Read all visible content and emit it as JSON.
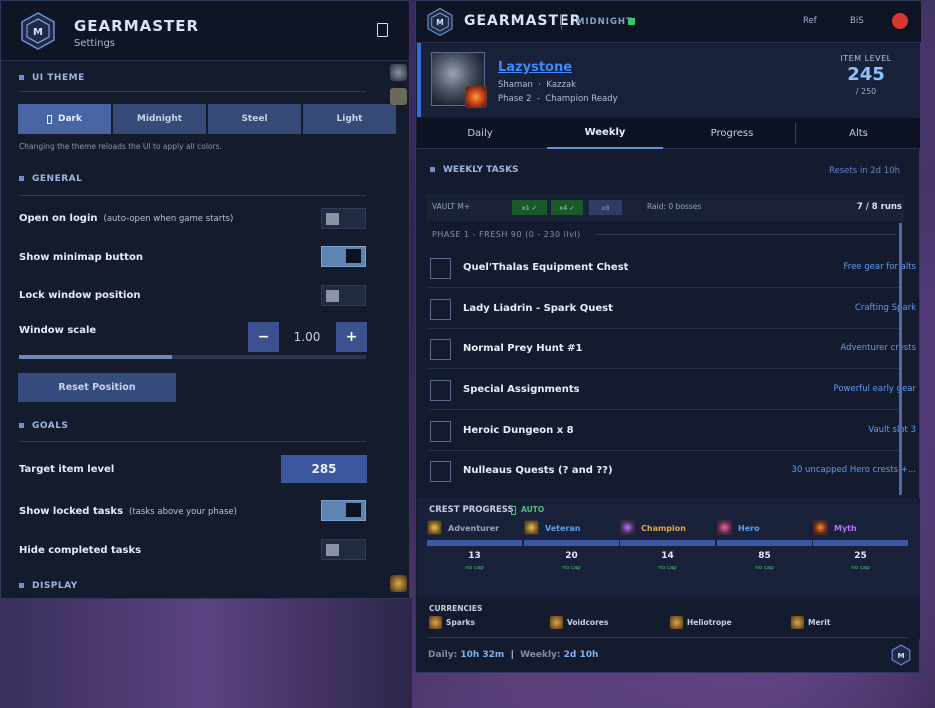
{
  "settings": {
    "app_title": "GEARMASTER",
    "subtitle": "Settings",
    "ui_theme": {
      "header": "UI THEME",
      "options": [
        "Dark",
        "Midnight",
        "Steel",
        "Light"
      ],
      "selected": "Dark",
      "note": "Changing the theme reloads the UI to apply all colors."
    },
    "general": {
      "header": "GENERAL",
      "open_on_login": {
        "label": "Open on login",
        "hint": "(auto-open when game starts)",
        "on": false
      },
      "show_minimap": {
        "label": "Show minimap button",
        "on": true
      },
      "lock_window": {
        "label": "Lock window position",
        "on": false
      },
      "window_scale": {
        "label": "Window scale",
        "value": "1.00",
        "minus": "−",
        "plus": "+",
        "level": 0.44
      },
      "reset_label": "Reset Position"
    },
    "goals": {
      "header": "GOALS",
      "target_ilvl": {
        "label": "Target item level",
        "value": "285"
      },
      "show_locked": {
        "label": "Show locked tasks",
        "hint": "(tasks above your phase)",
        "on": true
      },
      "hide_completed": {
        "label": "Hide completed tasks",
        "on": false
      }
    },
    "display_header": "DISPLAY"
  },
  "tracker": {
    "app_title": "GEARMASTER",
    "theme_name": "MIDNIGHT",
    "links": [
      "Ref",
      "BiS"
    ],
    "character": {
      "name": "Lazystone",
      "class": "Shaman",
      "realm": "Kazzak",
      "phase": "Phase 2",
      "status": "Champion Ready",
      "item_level_label": "ITEM LEVEL",
      "item_level": "245",
      "item_level_max": "/ 250"
    },
    "tabs": [
      "Daily",
      "Weekly",
      "Progress",
      "Alts"
    ],
    "active_tab": "Weekly",
    "weekly": {
      "header": "WEEKLY TASKS",
      "reset": "Resets in 2d 10h",
      "vault_label": "VAULT M+",
      "vault_chips": [
        "x1 ✓",
        "x4 ✓",
        "x8"
      ],
      "raid": "Raid: 0 bosses",
      "runs": "7 / 8 runs",
      "phase_header": "PHASE 1  -  FRESH 90  (0 - 230 ilvl)",
      "tasks": [
        {
          "name": "Quel'Thalas Equipment Chest",
          "note": "Free gear for alts"
        },
        {
          "name": "Lady Liadrin  - Spark Quest",
          "note": "Crafting Spark"
        },
        {
          "name": "Normal Prey Hunt #1",
          "note": "Adventurer crests"
        },
        {
          "name": "Special Assignments",
          "note": "Powerful early gear"
        },
        {
          "name": "Heroic Dungeon  x 8",
          "note": "Vault slot 3"
        },
        {
          "name": "Nulleaus Quests  (? and ??)",
          "note": "30 uncapped Hero crests +..."
        }
      ]
    },
    "crests": {
      "header": "CREST PROGRESS",
      "auto": "AUTO",
      "items": [
        {
          "name": "Adventurer",
          "value": "13",
          "cap": "no cap",
          "color": "#9aa3b5"
        },
        {
          "name": "Veteran",
          "value": "20",
          "cap": "no cap",
          "color": "#5aa2e8"
        },
        {
          "name": "Champion",
          "value": "14",
          "cap": "no cap",
          "color": "#e0a843"
        },
        {
          "name": "Hero",
          "value": "85",
          "cap": "no cap",
          "color": "#5aa2e8"
        },
        {
          "name": "Myth",
          "value": "25",
          "cap": "no cap",
          "color": "#b874e8"
        }
      ]
    },
    "currencies": {
      "header": "CURRENCIES",
      "items": [
        "Sparks",
        "Voidcores",
        "Heliotrope",
        "Merit"
      ]
    },
    "footer": {
      "daily_label": "Daily:",
      "daily_value": "10h 32m",
      "sep": "|",
      "weekly_label": "Weekly:",
      "weekly_value": "2d 10h"
    }
  }
}
